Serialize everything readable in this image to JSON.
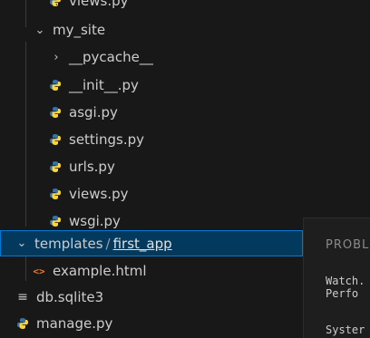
{
  "explorer": {
    "rows": [
      {
        "label": "views.py",
        "icon": "python-icon"
      },
      {
        "label": "my_site",
        "icon": "chevron-down-icon"
      },
      {
        "label": "__pycache__",
        "icon": "chevron-right-icon"
      },
      {
        "label": "__init__.py",
        "icon": "python-icon"
      },
      {
        "label": "asgi.py",
        "icon": "python-icon"
      },
      {
        "label": "settings.py",
        "icon": "python-icon"
      },
      {
        "label": "urls.py",
        "icon": "python-icon"
      },
      {
        "label": "views.py",
        "icon": "python-icon"
      },
      {
        "label": "wsgi.py",
        "icon": "python-icon"
      },
      {
        "label": "templates",
        "sublabel": "first_app",
        "separator": "/",
        "icon": "chevron-down-icon"
      },
      {
        "label": "example.html",
        "icon": "html-icon"
      },
      {
        "label": "db.sqlite3",
        "icon": "list-icon"
      },
      {
        "label": "manage.py",
        "icon": "python-icon"
      }
    ]
  },
  "panel": {
    "tab": "PROBL",
    "line1": "Watch.",
    "line2": "Perfo",
    "line3": "Syster"
  },
  "colors": {
    "selection_bg": "#04395e",
    "selection_border": "#0078d4",
    "python_blue": "#3572a5",
    "python_yellow": "#ffd43b",
    "html_orange": "#e37933"
  }
}
